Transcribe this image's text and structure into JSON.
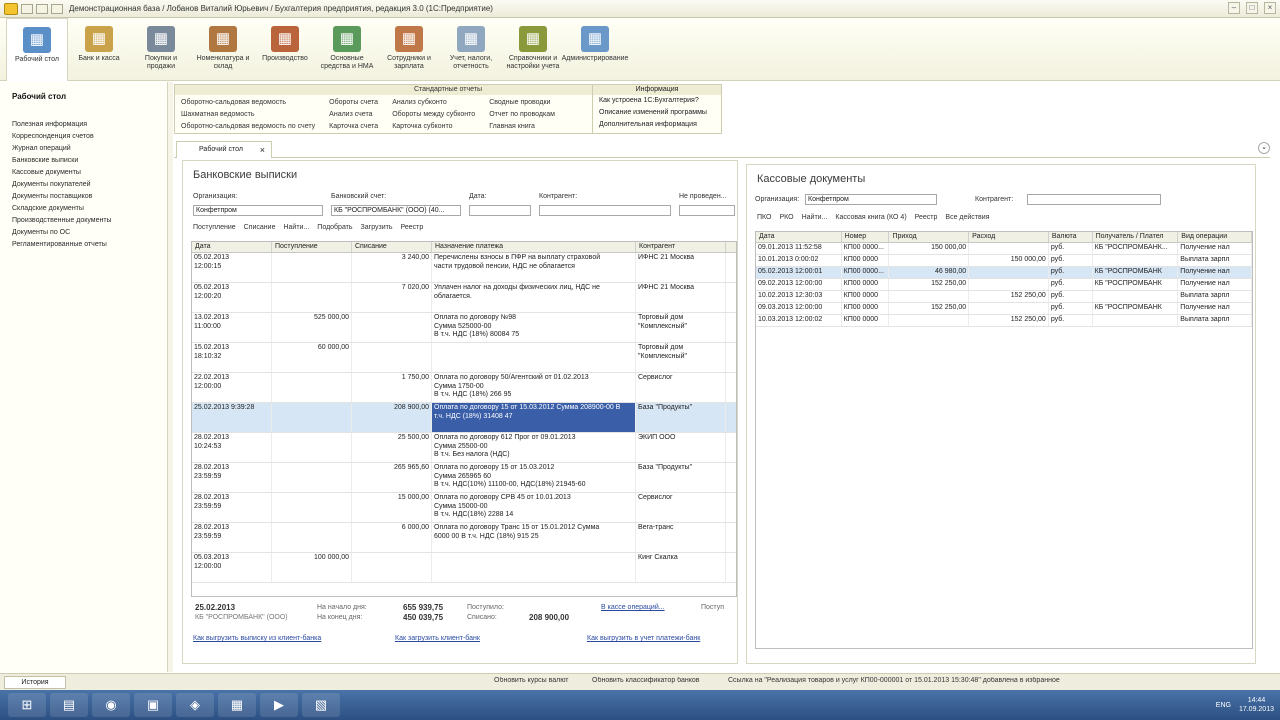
{
  "window": {
    "title": "Демонстрационная база / Лобанов Виталий Юрьевич / Бухгалтерия предприятия, редакция 3.0 (1С:Предприятие)"
  },
  "sections": [
    {
      "label": "Рабочий стол",
      "icon": "desktop-icon",
      "color": "#5a8fc8"
    },
    {
      "label": "Банк и касса",
      "icon": "bank-icon",
      "color": "#c9a24a"
    },
    {
      "label": "Покупки и продажи",
      "icon": "cart-icon",
      "color": "#7b8a9a"
    },
    {
      "label": "Номенклатура и склад",
      "icon": "warehouse-icon",
      "color": "#b07840"
    },
    {
      "label": "Производство",
      "icon": "factory-icon",
      "color": "#b9643a"
    },
    {
      "label": "Основные средства и НМА",
      "icon": "building-icon",
      "color": "#5a9a5a"
    },
    {
      "label": "Сотрудники и зарплата",
      "icon": "employee-icon",
      "color": "#c07848"
    },
    {
      "label": "Учет, налоги, отчетность",
      "icon": "report-icon",
      "color": "#8fa8c0"
    },
    {
      "label": "Справочники и настройки учета",
      "icon": "books-icon",
      "color": "#8a9a3a"
    },
    {
      "label": "Администрирование",
      "icon": "admin-icon",
      "color": "#6a98c8"
    }
  ],
  "left_panel": {
    "title": "Рабочий стол",
    "items": [
      "Полезная информация",
      "Корреспонденция счетов",
      "Журнал операций",
      "Банковские выписки",
      "Кассовые документы",
      "Документы покупателей",
      "Документы поставщиков",
      "Складские документы",
      "Производственные документы",
      "Документы по ОС",
      "Регламентированные отчеты"
    ]
  },
  "standard_reports": {
    "caption": "Стандартные отчеты",
    "columns": [
      [
        "Оборотно-сальдовая ведомость",
        "Шахматная ведомость",
        "Оборотно-сальдовая ведомость по счету"
      ],
      [
        "Обороты счета",
        "Анализ счета",
        "Карточка счета"
      ],
      [
        "Анализ субконто",
        "Обороты между субконто",
        "Карточка субконто"
      ],
      [
        "Сводные проводки",
        "Отчет по проводкам",
        "Главная книга"
      ]
    ]
  },
  "info_box": {
    "caption": "Информация",
    "items": [
      "Как устроена 1С:Бухгалтерия?",
      "Описание изменений программы",
      "Дополнительная информация"
    ]
  },
  "tab": {
    "label": "Рабочий стол"
  },
  "bank": {
    "title": "Банковские выписки",
    "org_label": "Организация:",
    "org_value": "Конфетпром",
    "account_label": "Банковский счет:",
    "account_value": "КБ \"РОСПРОМБАНК\" (ООО) (40...",
    "date_label": "Дата:",
    "contractor_label": "Контрагент:",
    "not_posted_label": "Не проведен...",
    "toolbar": [
      "Поступление",
      "Списание",
      "Найти...",
      "Подобрать",
      "Загрузить",
      "Реестр"
    ],
    "columns": [
      "Дата",
      "Поступление",
      "Списание",
      "Назначение платежа",
      "Контрагент"
    ],
    "rows": [
      {
        "date": "05.02.2013\n12:00:15",
        "in": "",
        "out": "3 240,00",
        "purpose": "Перечислены взносы в ПФР на выплату страховой\nчасти трудовой пенсии, НДС не облагается",
        "contractor": "ИФНС 21 Москва"
      },
      {
        "date": "05.02.2013\n12:00:20",
        "in": "",
        "out": "7 020,00",
        "purpose": "Уплачен налог на доходы физических лиц, НДС не\nоблагается.",
        "contractor": "ИФНС 21 Москва"
      },
      {
        "date": "13.02.2013\n11:00:00",
        "in": "525 000,00",
        "out": "",
        "purpose": "Оплата по договору №98\nСумма 525000-00\nВ т.ч. НДС (18%) 80084 75",
        "contractor": "Торговый дом\n\"Комплексный\""
      },
      {
        "date": "15.02.2013\n18:10:32",
        "in": "60 000,00",
        "out": "",
        "purpose": "",
        "contractor": "Торговый дом\n\"Комплексный\""
      },
      {
        "date": "22.02.2013\n12:00:00",
        "in": "",
        "out": "1 750,00",
        "purpose": "Оплата по договору 50/Агентский от 01.02.2013\nСумма 1750-00\nВ т.ч. НДС (18%) 266 95",
        "contractor": "Сервислог"
      },
      {
        "date": "25.02.2013 9:39:28",
        "in": "",
        "out": "208 900,00",
        "purpose": "Оплата по договору 15 от 15.03.2012 Сумма 208900-00 В\nт.ч. НДС (18%) 31408 47",
        "contractor": "База \"Продукты\"",
        "selected": true
      },
      {
        "date": "28.02.2013\n10:24:53",
        "in": "",
        "out": "25 500,00",
        "purpose": "Оплата по договору 612 Прог от 09.01.2013\nСумма 25500-00\nВ т.ч. Без налога (НДС)",
        "contractor": "ЭКИП ООО"
      },
      {
        "date": "28.02.2013\n23:59:59",
        "in": "",
        "out": "265 965,60",
        "purpose": "Оплата по договору 15 от 15.03.2012\nСумма 265965 60\nВ т.ч. НДС(10%) 11100-00, НДС(18%) 21945-60",
        "contractor": "База \"Продукты\""
      },
      {
        "date": "28.02.2013\n23:59:59",
        "in": "",
        "out": "15 000,00",
        "purpose": "Оплата по договору СРВ 45 от 10.01.2013\nСумма 15000-00\nВ т.ч. НДС(18%) 2288 14",
        "contractor": "Сервислог"
      },
      {
        "date": "28.02.2013\n23:59:59",
        "in": "",
        "out": "6 000,00",
        "purpose": "Оплата по договору Транс 15 от 15.01.2012 Сумма\n6000 00 В т.ч. НДС (18%) 915 25",
        "contractor": "Вега-транс"
      },
      {
        "date": "05.03.2013\n12:00:00",
        "in": "100 000,00",
        "out": "",
        "purpose": "",
        "contractor": "Кинг Скалка"
      }
    ],
    "summary": {
      "date": "25.02.2013",
      "bank": "КБ \"РОСПРОМБАНК\" (ООО)",
      "start_label": "На начало дня:",
      "start_value": "655 939,75",
      "end_label": "На конец дня:",
      "end_value": "450 039,75",
      "in_label": "Поступило:",
      "in_value": "",
      "out_label": "Списано:",
      "out_value": "208 900,00",
      "link_cases": "В кассе операций...",
      "cut_label": "Поступ"
    },
    "links": [
      "Как выгрузить выписку из клиент-банка",
      "Как загрузить клиент-банк",
      "Как выгрузить в учет платежи-банк"
    ]
  },
  "cash": {
    "title": "Кассовые документы",
    "org_label": "Организация:",
    "org_value": "Конфетпром",
    "contractor_label": "Контрагент:",
    "toolbar": [
      "ПКО",
      "РКО",
      "Найти...",
      "Кассовая книга (КО 4)",
      "Реестр",
      "Все действия"
    ],
    "columns": [
      "Дата",
      "Номер",
      "Приход",
      "Расход",
      "Валюта",
      "Получатель / Плател",
      "Вид операции"
    ],
    "rows": [
      {
        "date": "09.01.2013 11:52:58",
        "num": "КП00 0000...",
        "in": "150 000,00",
        "out": "",
        "cur": "руб.",
        "party": "КБ \"РОСПРОМБАНК...",
        "op": "Получение нал"
      },
      {
        "date": "10.01.2013 0:00:02",
        "num": "КП00 0000",
        "in": "",
        "out": "150 000,00",
        "cur": "руб.",
        "party": "",
        "op": "Выплата зарпл"
      },
      {
        "date": "05.02.2013 12:00:01",
        "num": "КП00 0000...",
        "in": "46 980,00",
        "out": "",
        "cur": "руб.",
        "party": "КБ \"РОСПРОМБАНК",
        "op": "Получение нал",
        "selected": true
      },
      {
        "date": "09.02.2013 12:00:00",
        "num": "КП00 0000",
        "in": "152 250,00",
        "out": "",
        "cur": "руб.",
        "party": "КБ \"РОСПРОМБАНК",
        "op": "Получение нал"
      },
      {
        "date": "10.02.2013 12:30:03",
        "num": "КП00 0000",
        "in": "",
        "out": "152 250,00",
        "cur": "руб.",
        "party": "",
        "op": "Выплата зарпл"
      },
      {
        "date": "09.03.2013 12:00:00",
        "num": "КП00 0000",
        "in": "152 250,00",
        "out": "",
        "cur": "руб.",
        "party": "КБ \"РОСПРОМБАНК",
        "op": "Получение нал"
      },
      {
        "date": "10.03.2013 12:00:02",
        "num": "КП00 0000",
        "in": "",
        "out": "152 250,00",
        "cur": "руб.",
        "party": "",
        "op": "Выплата зарпл"
      }
    ]
  },
  "status": {
    "history": "История",
    "messages": [
      "Обновить курсы валют",
      "Обновить классификатор банков",
      "Ссылка на \"Реализация товаров и услуг КП00-000001 от 15.01.2013 15:30:48\" добавлена в избранное"
    ]
  },
  "taskbar": {
    "icons": [
      "windows-start-icon",
      "explorer-icon",
      "chrome-icon",
      "installer-icon",
      "1c-icon",
      "terminal-icon",
      "powerpoint-icon",
      "tool-icon"
    ],
    "lang": "ENG",
    "time": "14:44",
    "date": "17.09.2013"
  }
}
